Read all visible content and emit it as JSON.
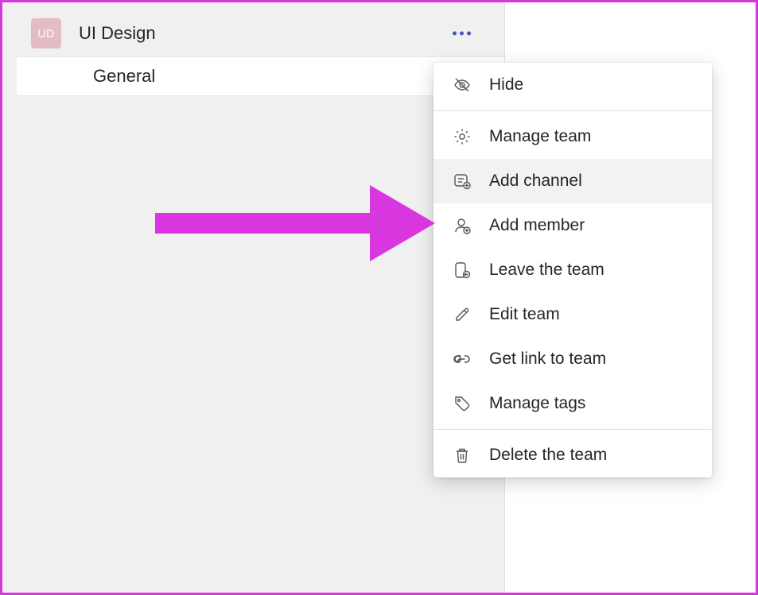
{
  "team": {
    "avatar_initials": "UD",
    "name": "UI Design"
  },
  "channels": [
    {
      "name": "General"
    }
  ],
  "menu": {
    "hide": "Hide",
    "manage_team": "Manage team",
    "add_channel": "Add channel",
    "add_member": "Add member",
    "leave_team": "Leave the team",
    "edit_team": "Edit team",
    "get_link": "Get link to team",
    "manage_tags": "Manage tags",
    "delete_team": "Delete the team"
  },
  "colors": {
    "accent_magenta": "#d837e0",
    "teams_purple": "#4b53bc",
    "avatar_bg": "#e3bdc4"
  }
}
